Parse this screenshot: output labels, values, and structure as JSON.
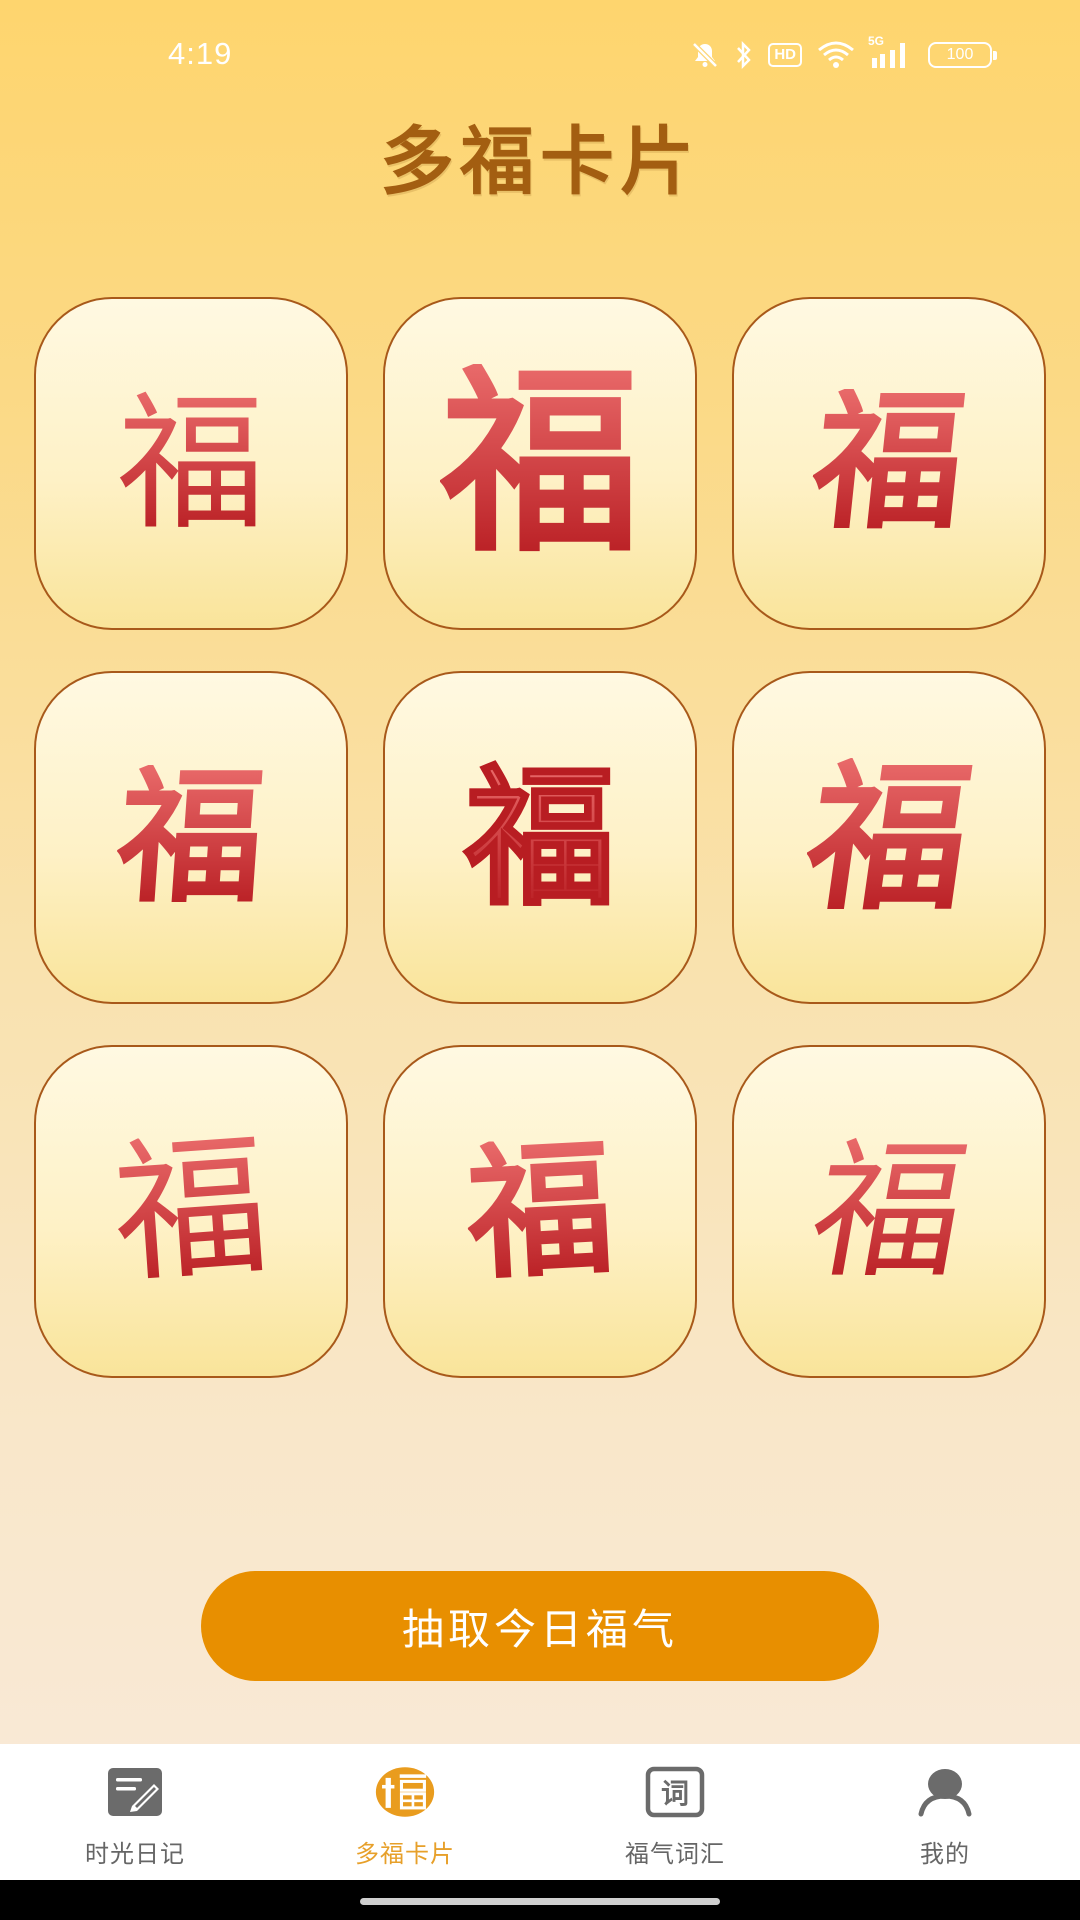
{
  "status_bar": {
    "time": "4:19",
    "hd_label": "HD",
    "network_label": "5G",
    "battery_level": "100",
    "icons": [
      "mute-icon",
      "bluetooth-icon",
      "hd-icon",
      "wifi-icon",
      "signal-icon",
      "battery-icon"
    ]
  },
  "page": {
    "title": "多福卡片"
  },
  "cards": [
    {
      "glyph": "福"
    },
    {
      "glyph": "福"
    },
    {
      "glyph": "福"
    },
    {
      "glyph": "福"
    },
    {
      "glyph": "福"
    },
    {
      "glyph": "福"
    },
    {
      "glyph": "福"
    },
    {
      "glyph": "福"
    },
    {
      "glyph": "福"
    }
  ],
  "draw_button": {
    "label": "抽取今日福气"
  },
  "bottom_nav": {
    "active_index": 1,
    "items": [
      {
        "label": "时光日记",
        "icon": "diary-icon"
      },
      {
        "label": "多福卡片",
        "icon": "fu-icon"
      },
      {
        "label": "福气词汇",
        "icon": "vocab-icon"
      },
      {
        "label": "我的",
        "icon": "profile-icon"
      }
    ]
  },
  "colors": {
    "title": "#A35E11",
    "card_border": "#A8591A",
    "glyph_top": "#E96A6A",
    "glyph_bottom": "#B81D22",
    "button": "#E88F00",
    "nav_active": "#E7A02A",
    "nav_inactive": "#666666"
  }
}
